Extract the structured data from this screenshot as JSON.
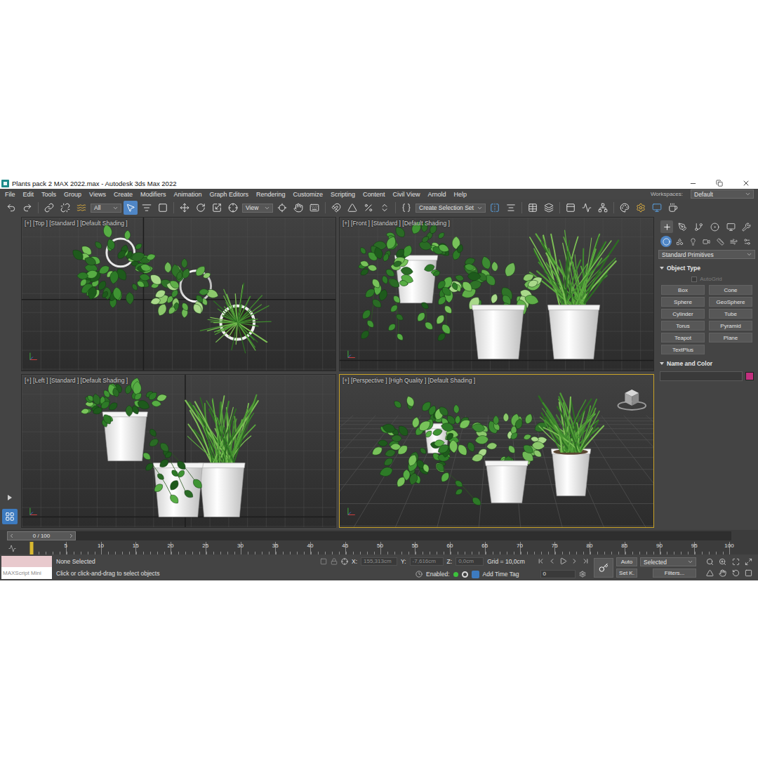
{
  "window": {
    "title": "Plants pack 2 MAX 2022.max - Autodesk 3ds Max 2022"
  },
  "menu_bar": {
    "items": [
      "File",
      "Edit",
      "Tools",
      "Group",
      "Views",
      "Create",
      "Modifiers",
      "Animation",
      "Graph Editors",
      "Rendering",
      "Customize",
      "Scripting",
      "Content",
      "Civil View",
      "Arnold",
      "Help"
    ],
    "workspaces_label": "Workspaces:",
    "workspace": "Default"
  },
  "toolbar": {
    "items": [
      {
        "kind": "icon",
        "selected": false
      },
      {
        "kind": "icon",
        "selected": false
      },
      {
        "kind": "separator"
      },
      {
        "kind": "icon",
        "selected": false
      },
      {
        "kind": "icon",
        "selected": false
      },
      {
        "kind": "icon",
        "selected": false
      },
      {
        "kind": "dropdown",
        "label": "All"
      },
      {
        "kind": "icon",
        "selected": true
      },
      {
        "kind": "icon",
        "selected": false
      },
      {
        "kind": "icon",
        "selected": false
      },
      {
        "kind": "separator"
      },
      {
        "kind": "icon",
        "selected": false
      },
      {
        "kind": "icon",
        "selected": false
      },
      {
        "kind": "icon",
        "selected": false
      },
      {
        "kind": "icon",
        "selected": false
      },
      {
        "kind": "dropdown",
        "label": "View"
      },
      {
        "kind": "icon",
        "selected": false
      },
      {
        "kind": "icon",
        "selected": false
      },
      {
        "kind": "icon",
        "selected": false
      },
      {
        "kind": "separator"
      },
      {
        "kind": "icon",
        "selected": false
      },
      {
        "kind": "icon",
        "selected": false
      },
      {
        "kind": "icon",
        "selected": false
      },
      {
        "kind": "icon",
        "selected": false
      },
      {
        "kind": "separator"
      },
      {
        "kind": "icon",
        "selected": false
      },
      {
        "kind": "dropdown",
        "label": "Create Selection Set"
      },
      {
        "kind": "icon",
        "selected": false
      },
      {
        "kind": "icon",
        "selected": false
      },
      {
        "kind": "separator"
      },
      {
        "kind": "icon",
        "selected": false
      },
      {
        "kind": "icon",
        "selected": false
      },
      {
        "kind": "separator"
      },
      {
        "kind": "icon",
        "selected": false
      },
      {
        "kind": "icon",
        "selected": false
      },
      {
        "kind": "icon",
        "selected": false
      },
      {
        "kind": "separator"
      },
      {
        "kind": "icon",
        "selected": false
      },
      {
        "kind": "icon",
        "selected": false
      },
      {
        "kind": "icon",
        "selected": false
      },
      {
        "kind": "icon",
        "selected": false
      }
    ]
  },
  "viewports": [
    {
      "label": "[+] [Top ] [Standard ] [Default Shading ]",
      "kind": "top",
      "active": false
    },
    {
      "label": "[+] [Front ] [Standard ] [Default Shading ]",
      "kind": "front",
      "active": false
    },
    {
      "label": "[+] [Left ] [Standard ] [Default Shading ]",
      "kind": "left",
      "active": false
    },
    {
      "label": "[+] [Perspective ] [High Quality ] [Default Shading ]",
      "kind": "perspective",
      "active": true
    }
  ],
  "command_panel": {
    "tabs": [
      {
        "selected": true
      },
      {
        "selected": false
      },
      {
        "selected": false
      },
      {
        "selected": false
      },
      {
        "selected": false
      },
      {
        "selected": false
      }
    ],
    "categories": [
      {
        "selected": true
      },
      {
        "selected": false
      },
      {
        "selected": false
      },
      {
        "selected": false
      },
      {
        "selected": false
      },
      {
        "selected": false
      },
      {
        "selected": false
      }
    ],
    "category_dropdown": "Standard Primitives",
    "object_type": {
      "title": "Object Type",
      "autogrid": {
        "label": "AutoGrid",
        "checked": false,
        "disabled": true
      },
      "buttons": [
        "Box",
        "Cone",
        "Sphere",
        "GeoSphere",
        "Cylinder",
        "Tube",
        "Torus",
        "Pyramid",
        "Teapot",
        "Plane",
        "TextPlus"
      ]
    },
    "name_and_color": {
      "title": "Name and Color",
      "name": "",
      "color": "#c2307e"
    }
  },
  "timeline": {
    "slider": "0 / 100",
    "level": 0,
    "ticks": [
      "5",
      "10",
      "15",
      "20",
      "25",
      "30",
      "35",
      "40",
      "45",
      "50",
      "55",
      "60",
      "65",
      "70",
      "75",
      "80",
      "85",
      "90",
      "95",
      "100"
    ]
  },
  "status_bar": {
    "maxscript": "MAXScript Mini",
    "selection": "None Selected",
    "prompt": "Click or click-and-drag to select objects",
    "x_label": "X:",
    "x": "155,313cm",
    "y_label": "Y:",
    "y": "-7,616cm",
    "z_label": "Z:",
    "z": "0,0cm",
    "grid": "Grid = 10,0cm",
    "enabled_label": "Enabled:",
    "enabled": true,
    "add_time_tag": "Add Time Tag",
    "frame": "0",
    "auto_key": "Auto",
    "key_filter": "Selected",
    "set_key": "Set K.",
    "filters": "Filters..."
  }
}
